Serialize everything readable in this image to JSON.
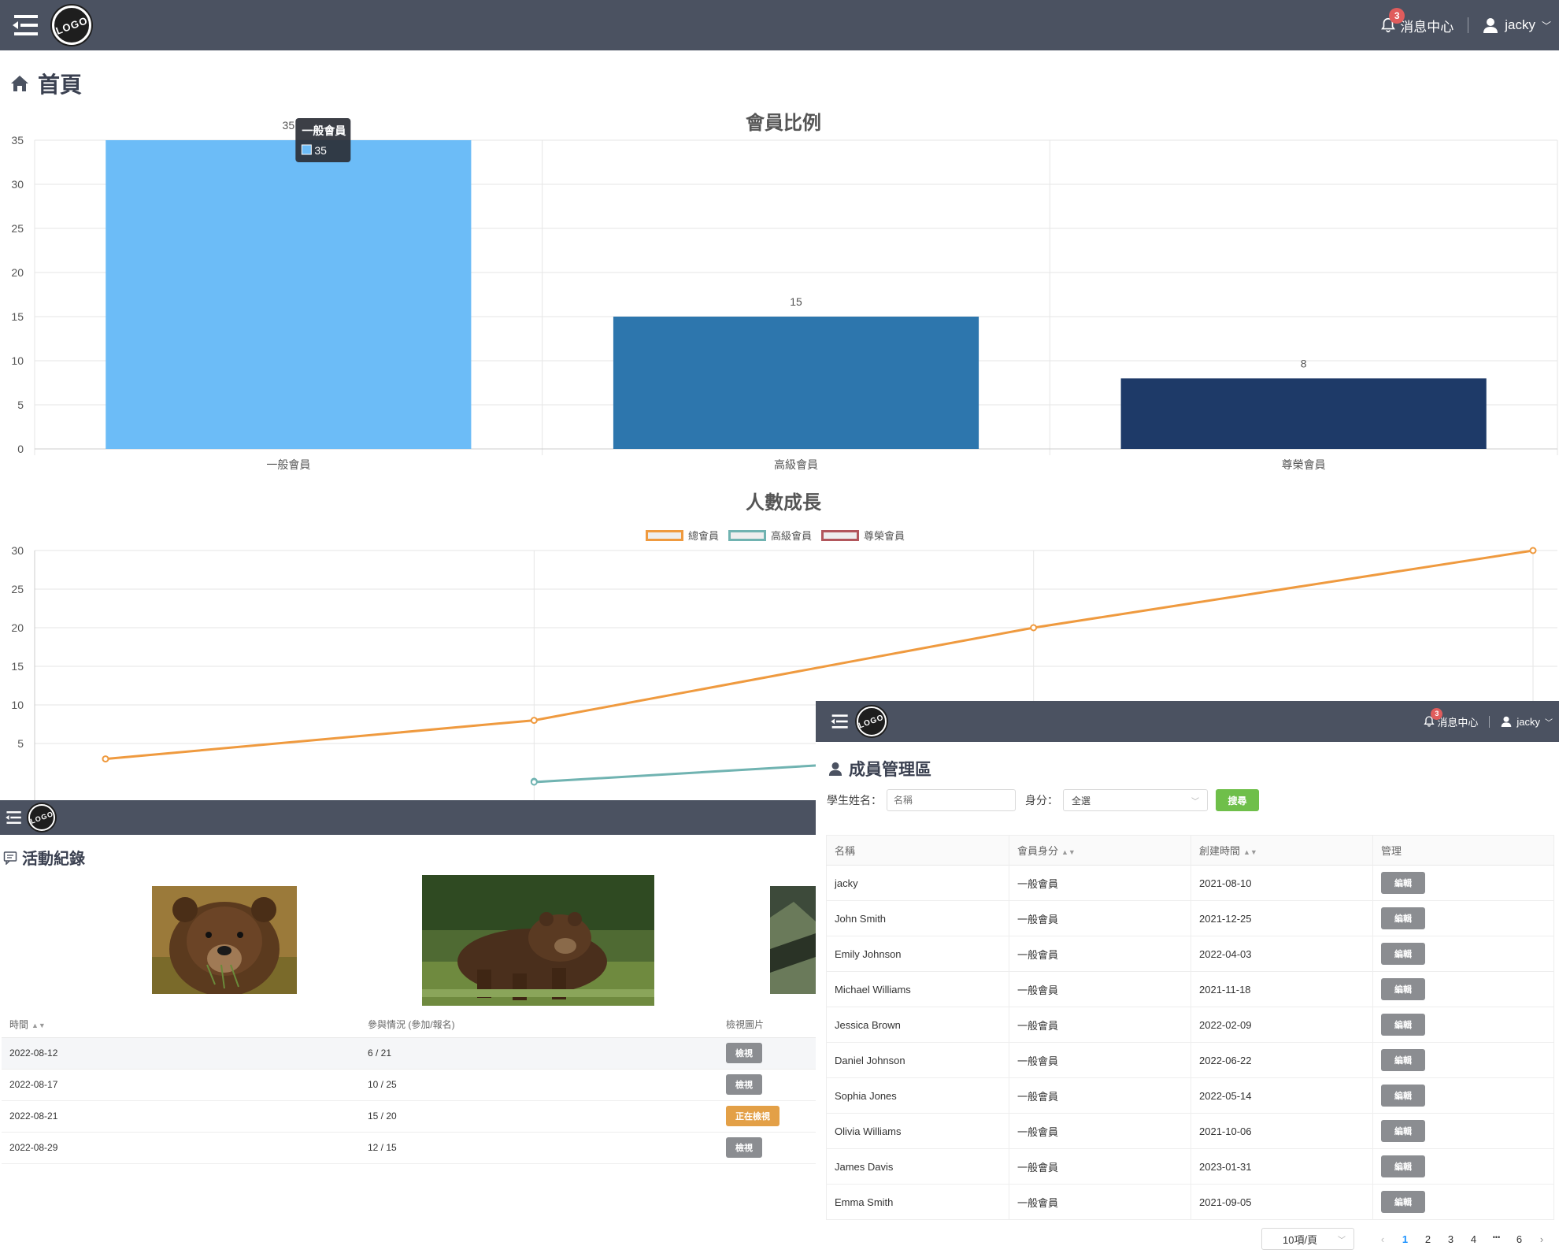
{
  "top_nav": {
    "logo": "LOGO",
    "bell_count": "3",
    "messages": "消息中心",
    "user": "jacky"
  },
  "home": {
    "title": "首頁"
  },
  "bar_chart": {
    "title": "會員比例",
    "tooltip_title": "一般會員",
    "tooltip_value": "35",
    "y_ticks": [
      "0",
      "5",
      "10",
      "15",
      "20",
      "25",
      "30",
      "35"
    ]
  },
  "line_chart": {
    "title": "人數成長",
    "y_ticks": [
      "5",
      "10",
      "15",
      "20",
      "25",
      "30"
    ]
  },
  "chart_data": [
    {
      "type": "bar",
      "title": "會員比例",
      "categories": [
        "一般會員",
        "高級會員",
        "尊榮會員"
      ],
      "values": [
        35,
        15,
        8
      ],
      "colors": [
        "#6cbcf7",
        "#2d76ad",
        "#1e3a68"
      ],
      "ylim": [
        0,
        35
      ],
      "grid": true
    },
    {
      "type": "line",
      "title": "人數成長",
      "series": [
        {
          "name": "總會員",
          "color": "#ef9a3f",
          "values": [
            3,
            8,
            20,
            30
          ]
        },
        {
          "name": "高級會員",
          "color": "#70b3b1",
          "values": [
            null,
            0,
            3.8,
            null
          ]
        },
        {
          "name": "尊榮會員",
          "color": "#b2565c",
          "values": []
        }
      ],
      "ylim": [
        0,
        30
      ],
      "grid": true
    }
  ],
  "activity": {
    "nav_logo": "LOGO",
    "title": "活動紀錄",
    "columns": [
      "時間",
      "參與情況 (參加/報名)",
      "檢視圖片"
    ],
    "rows": [
      {
        "date": "2022-08-12",
        "count": "6 / 21",
        "action": "檢視"
      },
      {
        "date": "2022-08-17",
        "count": "10 / 25",
        "action": "檢視"
      },
      {
        "date": "2022-08-21",
        "count": "15 / 20",
        "action": "正在檢視"
      },
      {
        "date": "2022-08-29",
        "count": "12 / 15",
        "action": "檢視"
      }
    ]
  },
  "members": {
    "nav_logo": "LOGO",
    "bell_count": "3",
    "messages": "消息中心",
    "user": "jacky",
    "title": "成員管理區",
    "name_label": "學生姓名：",
    "name_placeholder": "名稱",
    "role_label": "身分：",
    "role_value": "全選",
    "search_button": "搜尋",
    "columns": [
      "名稱",
      "會員身分",
      "創建時間",
      "管理"
    ],
    "rows": [
      {
        "name": "jacky",
        "role": "一般會員",
        "date": "2021-08-10",
        "action": "編輯"
      },
      {
        "name": "John Smith",
        "role": "一般會員",
        "date": "2021-12-25",
        "action": "編輯"
      },
      {
        "name": "Emily Johnson",
        "role": "一般會員",
        "date": "2022-04-03",
        "action": "編輯"
      },
      {
        "name": "Michael Williams",
        "role": "一般會員",
        "date": "2021-11-18",
        "action": "編輯"
      },
      {
        "name": "Jessica Brown",
        "role": "一般會員",
        "date": "2022-02-09",
        "action": "編輯"
      },
      {
        "name": "Daniel Johnson",
        "role": "一般會員",
        "date": "2022-06-22",
        "action": "編輯"
      },
      {
        "name": "Sophia Jones",
        "role": "一般會員",
        "date": "2022-05-14",
        "action": "編輯"
      },
      {
        "name": "Olivia Williams",
        "role": "一般會員",
        "date": "2021-10-06",
        "action": "編輯"
      },
      {
        "name": "James Davis",
        "role": "一般會員",
        "date": "2023-01-31",
        "action": "編輯"
      },
      {
        "name": "Emma Smith",
        "role": "一般會員",
        "date": "2021-09-05",
        "action": "編輯"
      }
    ],
    "page_size": "10項/頁",
    "pages": [
      "1",
      "2",
      "3",
      "4",
      "•••",
      "6"
    ],
    "current_page": "1"
  }
}
